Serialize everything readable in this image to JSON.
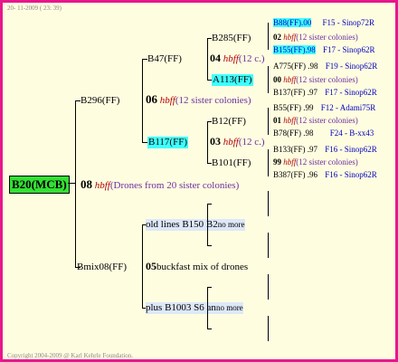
{
  "date": "20- 11-2009 ( 23: 39)",
  "footer": "Copyright 2004-2009 @ Karl Kehrle Foundation.",
  "root": {
    "name": "B20(MCB)"
  },
  "gen1": {
    "num": "08",
    "hbff": "hbff",
    "note": "(Drones from 20 sister colonies)",
    "top": "B296(FF)",
    "bottom": "Bmix08(FF)"
  },
  "gen2_top": {
    "num": "06",
    "hbff": "hbff",
    "note": "(12 sister colonies)",
    "a": "B47(FF)",
    "b": "B117(FF)"
  },
  "gen2_bottom": {
    "num": "05",
    "text": "buckfast mix of drones",
    "a": "old lines B150 B2",
    "a_more": "no more",
    "b": "plus B1003 S6 an",
    "b_more": "no more"
  },
  "gen3": {
    "g1": {
      "num": "04",
      "hbff": "hbff",
      "note": "(12 c.)",
      "a": "B285(FF)",
      "b": "A113(FF)"
    },
    "g2": {
      "num": "03",
      "hbff": "hbff",
      "note": "(12 c.)",
      "a": "B12(FF)",
      "b": "B101(FF)"
    }
  },
  "gen4": [
    {
      "name": "B88(FF)",
      "val": ".00",
      "code": "F15 - Sinop72R"
    },
    {
      "num": "02",
      "hbff": "hbff",
      "note": "(12 sister colonies)"
    },
    {
      "name": "B155(FF)",
      "val": ".98",
      "code": "F17 - Sinop62R"
    },
    {
      "name": "A775(FF)",
      "val": ".98",
      "code": "F19 - Sinop62R"
    },
    {
      "num": "00",
      "hbff": "hbff",
      "note": "(12 sister colonies)"
    },
    {
      "name": "B137(FF)",
      "val": ".97",
      "code": "F17 - Sinop62R"
    },
    {
      "name": "B55(FF)",
      "val": ".99",
      "code": "F12 - Adami75R"
    },
    {
      "num": "01",
      "hbff": "hbff",
      "note": "(12 sister colonies)"
    },
    {
      "name": "B78(FF)",
      "val": ".98",
      "code": "F24 - B-xx43"
    },
    {
      "name": "B133(FF)",
      "val": ".97",
      "code": "F16 - Sinop62R"
    },
    {
      "num": "99",
      "hbff": "hbff",
      "note": "(12 sister colonies)"
    },
    {
      "name": "B387(FF)",
      "val": ".96",
      "code": "F16 - Sinop62R"
    }
  ]
}
